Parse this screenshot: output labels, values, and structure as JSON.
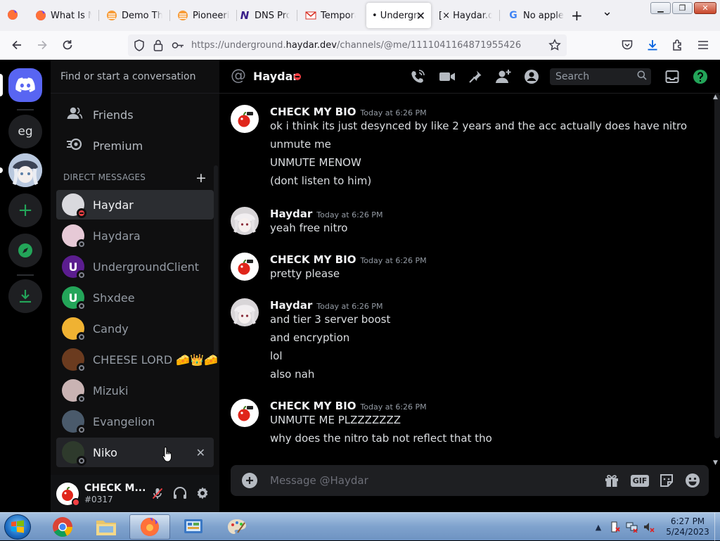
{
  "browser": {
    "tabs": [
      {
        "title": "What Is My IP",
        "favicon": "firefox-icon",
        "active": false
      },
      {
        "title": "Demo The",
        "favicon": "orange-stack-icon",
        "active": false
      },
      {
        "title": "Pioneering",
        "favicon": "orange-stack-icon",
        "active": false
      },
      {
        "title": "DNS Prop",
        "favicon": "N",
        "active": false
      },
      {
        "title": "Temporar",
        "favicon": "mail-icon",
        "active": false
      },
      {
        "title": "• Undergro",
        "favicon": "",
        "active": true
      },
      {
        "title": "[× Haydar.dev",
        "favicon": "",
        "active": false
      },
      {
        "title": "No apple",
        "favicon": "G",
        "active": false
      }
    ],
    "new_tab": "+",
    "list_all_tabs": "⌄",
    "window_controls": [
      "minimize",
      "restore",
      "close"
    ],
    "url_prefix": "https://underground.",
    "url_domain": "haydar.dev",
    "url_path": "/channels/@me/1111041164871955426"
  },
  "discord": {
    "rail": {
      "items": [
        {
          "name": "home",
          "label": ""
        },
        {
          "name": "server-eg",
          "label": "eg"
        },
        {
          "name": "server-avatar",
          "label": ""
        },
        {
          "name": "add-server",
          "label": "+"
        },
        {
          "name": "explore",
          "label": ""
        },
        {
          "name": "download",
          "label": ""
        }
      ]
    },
    "sidebar": {
      "search_placeholder": "Find or start a conversation",
      "friends_label": "Friends",
      "premium_label": "Premium",
      "dm_header": "DIRECT MESSAGES",
      "dm_add": "+",
      "dms": [
        {
          "name": "Haydar",
          "status": "dnd",
          "selected": true,
          "avatar_color": "#d9d9de",
          "avatar_text": ""
        },
        {
          "name": "Haydara",
          "status": "offline",
          "selected": false,
          "avatar_color": "#e6c9d6",
          "avatar_text": ""
        },
        {
          "name": "UndergroundClient",
          "status": "offline",
          "selected": false,
          "avatar_color": "#5b1d8f",
          "avatar_text": "U"
        },
        {
          "name": "Shxdee",
          "status": "offline",
          "selected": false,
          "avatar_color": "#23a559",
          "avatar_text": "U"
        },
        {
          "name": "Candy",
          "status": "offline",
          "selected": false,
          "avatar_color": "#f0b232",
          "avatar_text": ""
        },
        {
          "name": "CHEESE LORD 🧀👑🧀",
          "status": "offline",
          "selected": false,
          "avatar_color": "#6b3b1f",
          "avatar_text": ""
        },
        {
          "name": "Mizuki",
          "status": "offline",
          "selected": false,
          "avatar_color": "#c9b3b3",
          "avatar_text": ""
        },
        {
          "name": "Evangelion",
          "status": "offline",
          "selected": false,
          "avatar_color": "#4a5a6b",
          "avatar_text": ""
        },
        {
          "name": "Niko",
          "status": "offline",
          "selected": false,
          "hovered": true,
          "avatar_color": "#2e3a2c",
          "avatar_text": ""
        }
      ],
      "close_dm": "✕"
    },
    "user_panel": {
      "name": "CHECK M...",
      "tag": "#0317"
    },
    "chat": {
      "channel_name": "Haydar",
      "search_placeholder": "Search",
      "composer_placeholder": "Message @Haydar",
      "gif_label": "GIF",
      "messages": [
        {
          "author": "CHECK MY BIO",
          "time": "Today at 6:26 PM",
          "avatar": "apple",
          "lines": [
            "ok i think its just desynced by like 2 years and the acc actually does have nitro",
            "unmute me",
            "UNMUTE MENOW",
            "(dont listen to him)"
          ]
        },
        {
          "author": "Haydar",
          "time": "Today at 6:26 PM",
          "avatar": "anime",
          "lines": [
            "yeah free nitro"
          ]
        },
        {
          "author": "CHECK MY BIO",
          "time": "Today at 6:26 PM",
          "avatar": "apple",
          "lines": [
            "pretty please"
          ]
        },
        {
          "author": "Haydar",
          "time": "Today at 6:26 PM",
          "avatar": "anime",
          "lines": [
            "and tier 3 server boost",
            "and encryption",
            "lol",
            "also nah"
          ]
        },
        {
          "author": "CHECK MY BIO",
          "time": "Today at 6:26 PM",
          "avatar": "apple",
          "lines": [
            "UNMUTE ME PLZZZZZZZ",
            "why does the nitro tab not reflect that tho"
          ]
        }
      ]
    }
  },
  "taskbar": {
    "apps": [
      "windows-explorer",
      "chrome",
      "file-manager",
      "firefox",
      "control-panel",
      "paint"
    ],
    "active_app": "firefox",
    "clock_time": "6:27 PM",
    "clock_date": "5/24/2023",
    "tray_expand": "▲"
  },
  "colors": {
    "discord_blurple": "#5865f2",
    "discord_green": "#23a559",
    "dnd_red": "#f23f43",
    "chat_bg": "#000000",
    "sidebar_bg": "#0f0f10"
  }
}
